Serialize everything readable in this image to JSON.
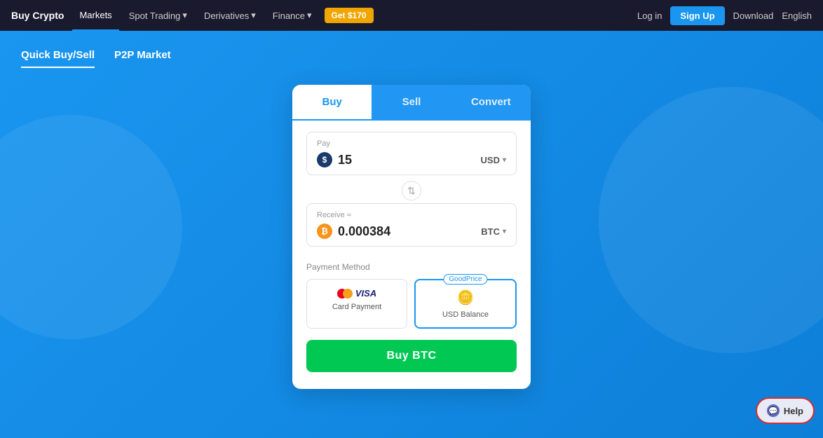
{
  "nav": {
    "brand": "Buy Crypto",
    "items": [
      {
        "label": "Markets",
        "active": false
      },
      {
        "label": "Spot Trading",
        "has_dropdown": true,
        "active": false
      },
      {
        "label": "Derivatives",
        "has_dropdown": true,
        "active": false
      },
      {
        "label": "Finance",
        "has_dropdown": true,
        "active": false
      }
    ],
    "promo": "Get $170",
    "login": "Log in",
    "signup": "Sign Up",
    "download": "Download",
    "language": "English"
  },
  "sub_nav": {
    "items": [
      {
        "label": "Quick Buy/Sell",
        "active": true
      },
      {
        "label": "P2P Market",
        "active": false
      }
    ]
  },
  "card": {
    "tabs": [
      {
        "label": "Buy",
        "active": true
      },
      {
        "label": "Sell",
        "active": false
      },
      {
        "label": "Convert",
        "active": false
      }
    ],
    "pay": {
      "label": "Pay",
      "value": "15",
      "currency": "USD"
    },
    "receive": {
      "label": "Receive ≈",
      "value": "0.000384",
      "currency": "BTC"
    },
    "payment_method": {
      "label": "Payment Method",
      "options": [
        {
          "id": "card",
          "name": "Card Payment",
          "badge": null,
          "selected": false
        },
        {
          "id": "balance",
          "name": "USD Balance",
          "badge": "GoodPrice",
          "selected": true
        }
      ]
    },
    "buy_button": "Buy BTC"
  },
  "help": {
    "label": "Help"
  }
}
